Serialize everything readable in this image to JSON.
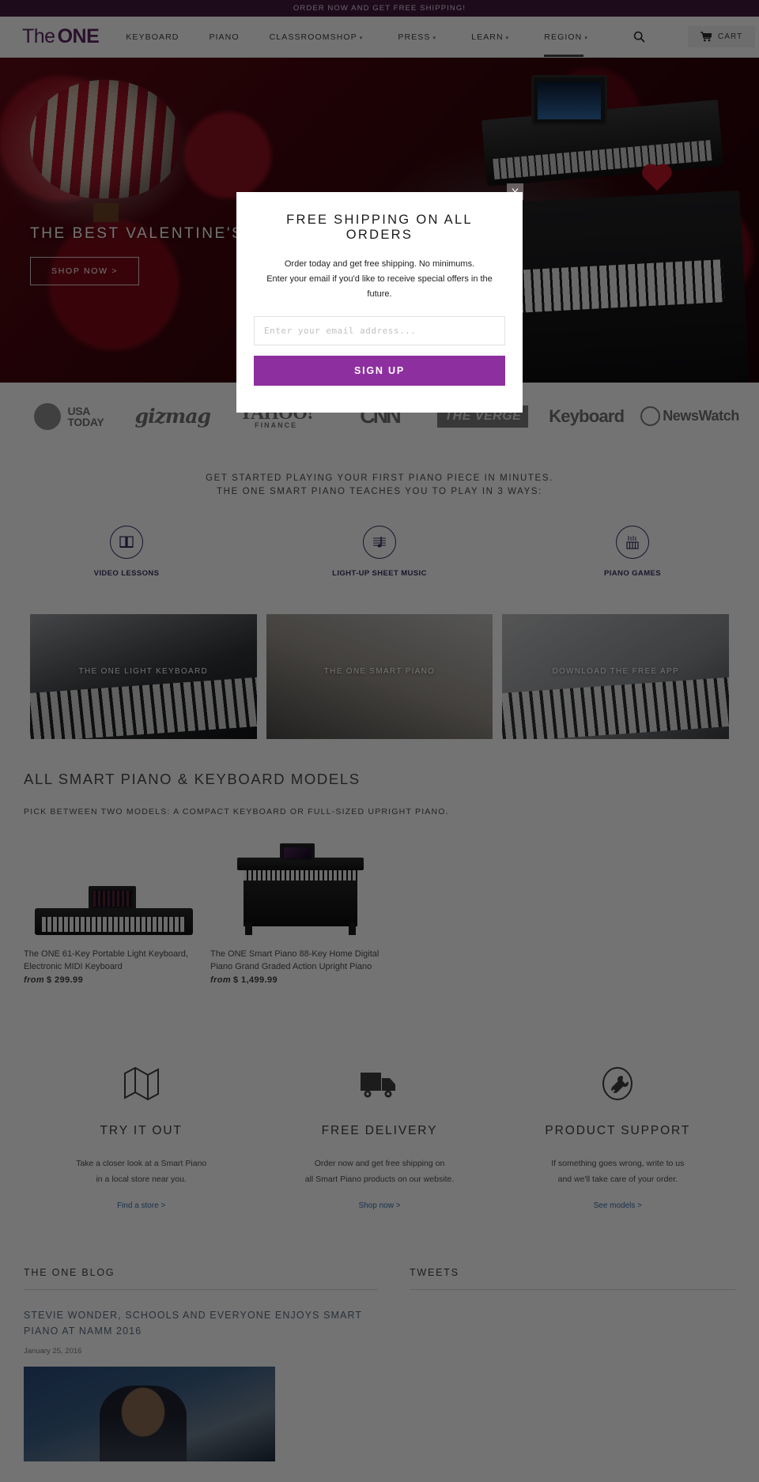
{
  "announcement": {
    "text": "ORDER NOW AND GET FREE SHIPPING!"
  },
  "header": {
    "logo_the": "The",
    "logo_one": "ONE",
    "primary_nav": [
      {
        "label": "KEYBOARD"
      },
      {
        "label": "PIANO"
      },
      {
        "label": "CLASSROOM"
      }
    ],
    "secondary_nav": [
      {
        "label": "SHOP",
        "caret": "▾"
      },
      {
        "label": "PRESS",
        "caret": "▾"
      },
      {
        "label": "LEARN",
        "caret": "▾"
      },
      {
        "label": "REGION",
        "caret": "▾"
      }
    ],
    "search_icon": "search-icon",
    "cart_label": "CART",
    "cart_icon": "cart-icon"
  },
  "hero": {
    "title": "THE BEST VALENTINE'S DAY GIFT EVER",
    "cta": "SHOP NOW >",
    "dots": 1
  },
  "press": {
    "logos": [
      {
        "name": "USA TODAY",
        "line1": "USA",
        "line2": "TODAY"
      },
      {
        "name": "gizmag",
        "text": "gizmag"
      },
      {
        "name": "Yahoo Finance",
        "line1": "YAHOO!",
        "line2": "FINANCE"
      },
      {
        "name": "CNN",
        "text": "CNN"
      },
      {
        "name": "The Verge",
        "text": "THE VERGE"
      },
      {
        "name": "Keyboard",
        "text": "Keyboard"
      },
      {
        "name": "NewsWatch",
        "text": "NewsWatch"
      }
    ]
  },
  "ways": {
    "headline_line1": "GET STARTED PLAYING YOUR FIRST PIANO PIECE IN MINUTES.",
    "headline_line2": "THE ONE SMART PIANO TEACHES YOU TO PLAY IN 3 WAYS:",
    "items": [
      {
        "label": "VIDEO LESSONS",
        "icon": "book-icon"
      },
      {
        "label": "LIGHT-UP SHEET MUSIC",
        "icon": "music-note-icon"
      },
      {
        "label": "PIANO GAMES",
        "icon": "piano-keys-icon"
      }
    ]
  },
  "tiles": [
    {
      "caption": "THE ONE LIGHT KEYBOARD"
    },
    {
      "caption": "THE ONE SMART PIANO"
    },
    {
      "caption": "DOWNLOAD THE FREE APP"
    }
  ],
  "models": {
    "title": "ALL SMART PIANO & KEYBOARD MODELS",
    "subtitle": "PICK BETWEEN TWO MODELS: A COMPACT KEYBOARD OR FULL-SIZED UPRIGHT PIANO.",
    "products": [
      {
        "name": "The ONE 61-Key Portable Light Keyboard, Electronic MIDI Keyboard",
        "price_from": "from",
        "price_currency": "$",
        "price_amount": "299.99"
      },
      {
        "name": "The ONE Smart Piano 88-Key Home Digital Piano Grand Graded Action Upright Piano",
        "price_from": "from",
        "price_currency": "$",
        "price_amount": "1,499.99"
      }
    ]
  },
  "features": [
    {
      "icon": "map-icon",
      "title": "TRY IT OUT",
      "line1": "Take a closer look at a Smart Piano",
      "line2": "in a local store near you.",
      "link": "Find a store >"
    },
    {
      "icon": "truck-icon",
      "title": "FREE DELIVERY",
      "line1": "Order now and get free shipping on",
      "line2": "all Smart Piano products on our website.",
      "link": "Shop now >"
    },
    {
      "icon": "wrench-icon",
      "title": "PRODUCT SUPPORT",
      "line1": "If something goes wrong, write to us",
      "line2": "and we'll take care of your order.",
      "link": "See models >"
    }
  ],
  "bottom": {
    "blog_heading": "THE ONE BLOG",
    "tweets_heading": "TWEETS",
    "post_title": "STEVIE WONDER, SCHOOLS AND EVERYONE ENJOYS SMART PIANO AT NAMM 2016",
    "post_date": "January 25, 2016"
  },
  "modal": {
    "close_label": "X",
    "title": "FREE SHIPPING ON ALL ORDERS",
    "text_line1": "Order today and get free shipping. No minimums.",
    "text_line2": "Enter your email if you'd like to receive special offers in the future.",
    "input_value": "",
    "input_placeholder": "Enter your email address...",
    "submit_label": "SIGN UP",
    "accent_color": "#8e2fa0"
  }
}
